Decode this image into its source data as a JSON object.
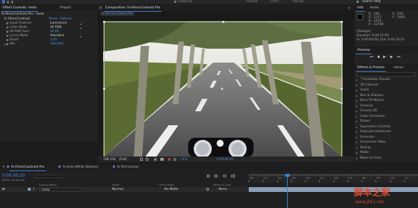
{
  "top_bar": {
    "snapping": "Snapping",
    "menus": [
      "Review",
      "Learn",
      "Standa"
    ],
    "search_placeholder": "Search Help"
  },
  "effect_controls": {
    "tab": "Effect Controls: moto",
    "tab_project": "Project",
    "layer_path": "fx-FilmicContrast Pro - moto",
    "effect_name": "fx FilmicContrast",
    "effect_reset": "Reset",
    "effect_options": "Options...",
    "properties": [
      {
        "name": "Input Channel",
        "value": "Luminance"
      },
      {
        "name": "Color Mode",
        "value": "All RGB"
      },
      {
        "name": "All RGB Gain",
        "value": "20,00"
      },
      {
        "name": "Curve Mode",
        "value": "Standard"
      },
      {
        "name": "Boost",
        "value": "0,00"
      },
      {
        "name": "Mix",
        "value": "100,00%"
      }
    ]
  },
  "composition": {
    "tab": "Composition: fx-FilmicContrast Pro",
    "comp_tab": "fx-FilmicContrast Pro",
    "footer": {
      "zoom": "(66,1%)",
      "resolution": "(Full)",
      "exposure": "+0,0",
      "timecode": "0:00:00:20"
    }
  },
  "info": {
    "tabs": [
      "Info",
      "Audio"
    ],
    "values": {
      "R": "R : 186",
      "G": "G : 1317",
      "B": "B : 1414",
      "A": "A : 32768",
      "X": "X : 616",
      "Y": "Y : 1000"
    },
    "footage": "[footage]",
    "duration": "Duration: 0:00:11:00",
    "in_out": "In: 0:00:00:00, Out: 0:00:10:23"
  },
  "preview": {
    "tab": "Preview"
  },
  "effects_presets": {
    "tab": "Effects & Presets",
    "tab2": "Librari",
    "items": [
      "* Animation Presets",
      "3D Channel",
      "Audio",
      "Blur & Sharpen",
      "Boris FX Mocha",
      "Channel",
      "Cinema 4D",
      "Color Correction",
      "Distort",
      "Expression Controls",
      "Fastcode-Stellarcom",
      "Generate",
      "Immersive Video",
      "Keying",
      "Matte",
      "Noise & Grain"
    ]
  },
  "timeline": {
    "tabs": [
      "fx-FilmicContrast Pro",
      "fx-Auto White Balance",
      "fx-Technicolor"
    ],
    "timecode": "0:00:00:20",
    "frames": "00020 (25.00 fps)",
    "columns": {
      "source": "Source Name",
      "mode": "Mode",
      "trkmat": "Track Matte",
      "parent": "Parent & Link"
    },
    "layer": {
      "index": "1",
      "name": "moto",
      "mode": "Normal",
      "trkmat": "No Matte",
      "parent": "None"
    },
    "ruler": [
      "00s",
      "01f",
      "02f",
      "03f",
      "04f",
      "05f",
      "06f",
      "07f",
      "08f",
      "09f",
      "10f",
      "11f"
    ]
  },
  "watermark": {
    "title": "脚本之家",
    "url": "www.jb51.net"
  }
}
